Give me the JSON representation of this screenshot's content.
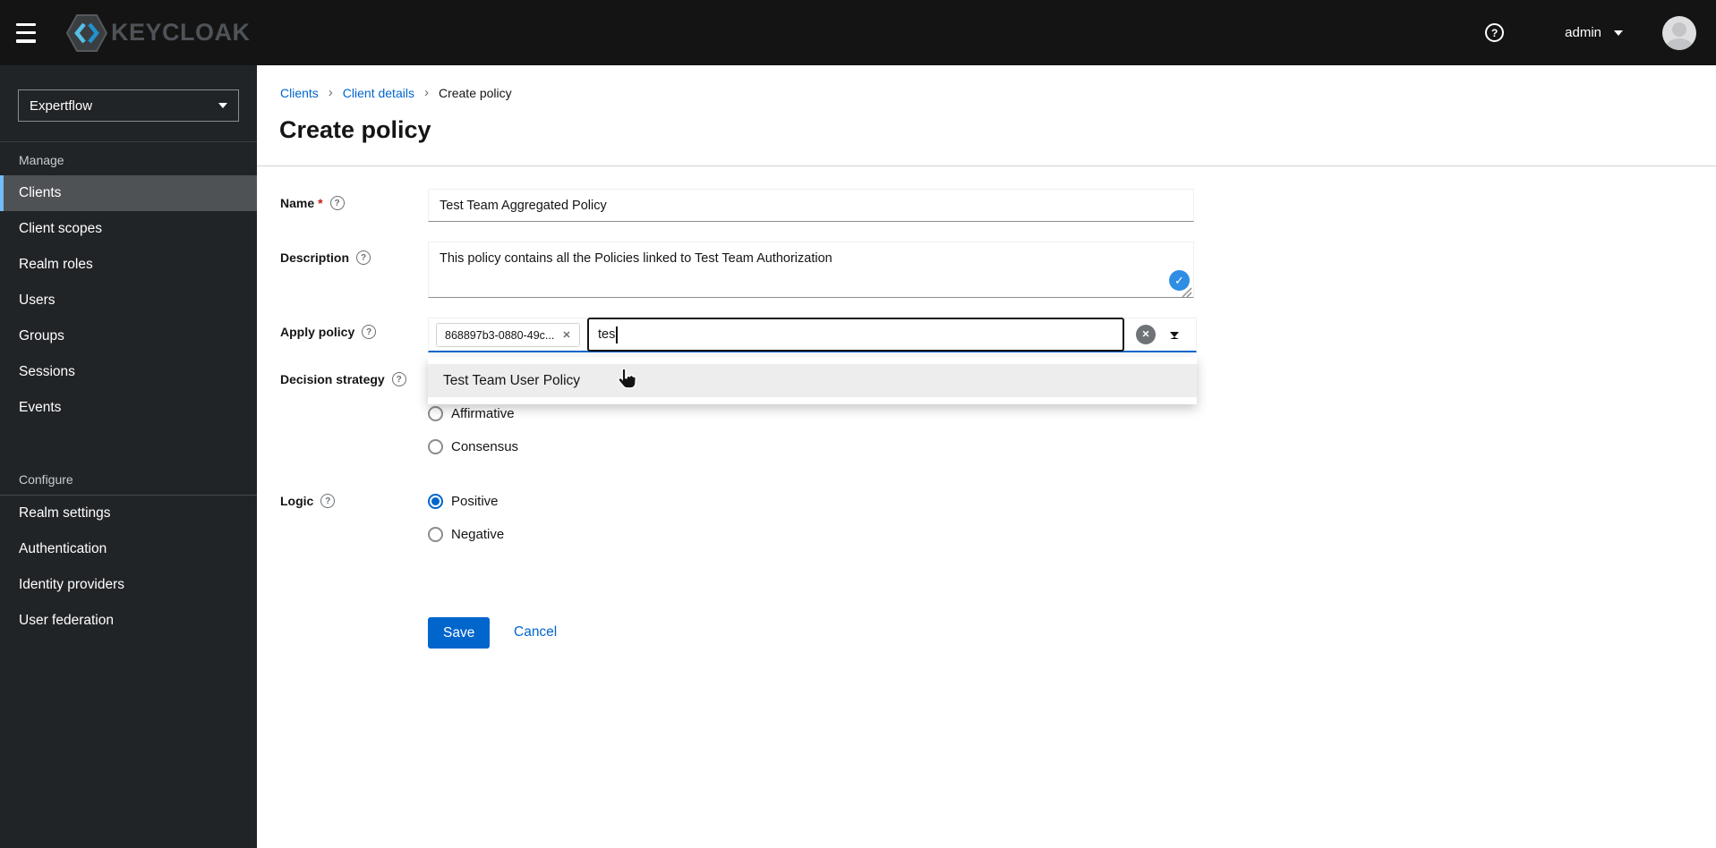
{
  "colors": {
    "accent": "#0066cc",
    "topbar_bg": "#141414",
    "sidebar_bg": "#212427",
    "nav_selected_bg": "#4f5255",
    "nav_selected_border": "#73bcf7",
    "focus_underline": "#0066cc",
    "check_badge_blue": "#2f8de4",
    "required_red": "#c9190b",
    "link_blue": "#0066cc"
  },
  "icons": {
    "question_mark": "?",
    "close": "✕",
    "check": "✓",
    "breadcrumb_separator": "›",
    "required_marker": "*"
  },
  "topbar": {
    "brand": "KEYCLOAK",
    "username": "admin"
  },
  "sidebar": {
    "realm": "Expertflow",
    "groups": [
      {
        "label": "Manage",
        "items": [
          {
            "label": "Clients",
            "selected": true
          },
          {
            "label": "Client scopes"
          },
          {
            "label": "Realm roles"
          },
          {
            "label": "Users"
          },
          {
            "label": "Groups"
          },
          {
            "label": "Sessions"
          },
          {
            "label": "Events"
          }
        ]
      },
      {
        "label": "Configure",
        "items": [
          {
            "label": "Realm settings"
          },
          {
            "label": "Authentication"
          },
          {
            "label": "Identity providers"
          },
          {
            "label": "User federation"
          }
        ]
      }
    ]
  },
  "breadcrumb": {
    "items": [
      {
        "label": "Clients"
      },
      {
        "label": "Client details"
      },
      {
        "label": "Create policy"
      }
    ]
  },
  "page": {
    "title": "Create policy"
  },
  "form": {
    "name": {
      "label": "Name",
      "required": true,
      "value": "Test Team Aggregated Policy"
    },
    "description": {
      "label": "Description",
      "value": "This policy contains all the Policies linked to Test Team Authorization"
    },
    "apply_policy": {
      "label": "Apply policy",
      "chips": [
        {
          "label": "868897b3-0880-49c..."
        }
      ],
      "input_value": "tes",
      "menu_items": [
        {
          "label": "Test Team User Policy"
        }
      ]
    },
    "decision_strategy": {
      "label": "Decision strategy",
      "options": [
        {
          "label": "Affirmative",
          "checked": false
        },
        {
          "label": "Consensus",
          "checked": false
        }
      ]
    },
    "logic": {
      "label": "Logic",
      "options": [
        {
          "label": "Positive",
          "checked": true
        },
        {
          "label": "Negative",
          "checked": false
        }
      ]
    },
    "actions": {
      "save": "Save",
      "cancel": "Cancel"
    }
  }
}
